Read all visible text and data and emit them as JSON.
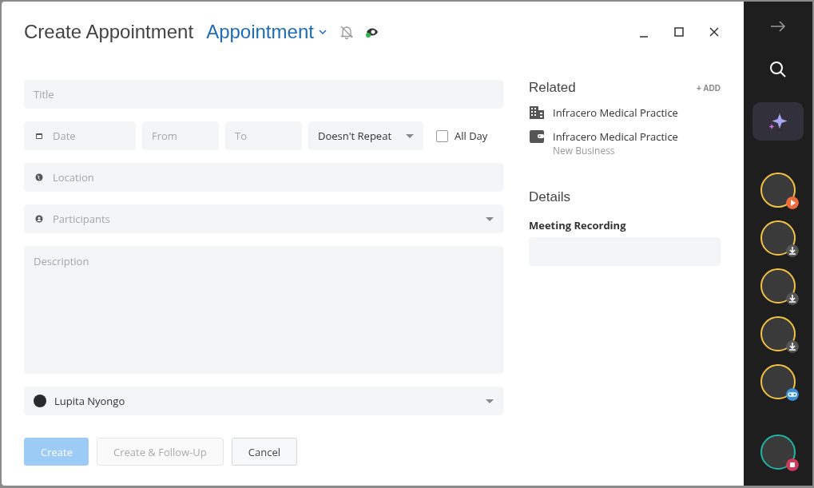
{
  "header": {
    "title": "Create Appointment",
    "type_label": "Appointment",
    "reminder_on": false,
    "visibility_on": true
  },
  "window_controls": [
    {
      "kind": "minimize"
    },
    {
      "kind": "maximize"
    },
    {
      "kind": "close"
    }
  ],
  "form": {
    "title": {
      "placeholder": "Title"
    },
    "date": {
      "placeholder": "Date"
    },
    "from": {
      "placeholder": "From"
    },
    "to": {
      "placeholder": "To"
    },
    "repeat": {
      "value": "Doesn't Repeat"
    },
    "all_day": {
      "label": "All Day",
      "checked": false
    },
    "location": {
      "placeholder": "Location"
    },
    "participants": {
      "placeholder": "Participants"
    },
    "description": {
      "placeholder": "Description"
    },
    "owner": {
      "value": "Lupita Nyongo"
    }
  },
  "buttons": [
    {
      "label": "Create",
      "kind": "primary",
      "disabled": true
    },
    {
      "label": "Create & Follow-Up",
      "kind": "secondary",
      "disabled": true
    },
    {
      "label": "Cancel",
      "kind": "secondary",
      "disabled": false
    }
  ],
  "related": {
    "title": "Related",
    "add_label": "+ ADD",
    "items": [
      {
        "kind": "company",
        "name": "Infracero Medical Practice"
      },
      {
        "kind": "deal",
        "name": "Infracero Medical Practice",
        "subtitle": "New Business"
      }
    ]
  },
  "details": {
    "title": "Details",
    "fields": [
      {
        "label": "Meeting Recording"
      }
    ]
  },
  "sidebar": {
    "items": [
      {
        "color": "#f5c342",
        "kind": "play"
      },
      {
        "color": "#f5c342",
        "kind": "download"
      },
      {
        "color": "#f5c342",
        "kind": "download"
      },
      {
        "color": "#f5c342",
        "kind": "download"
      },
      {
        "color": "#f5c342",
        "kind": "link"
      },
      {
        "color": "#1fb5a5",
        "kind": "record"
      }
    ]
  }
}
